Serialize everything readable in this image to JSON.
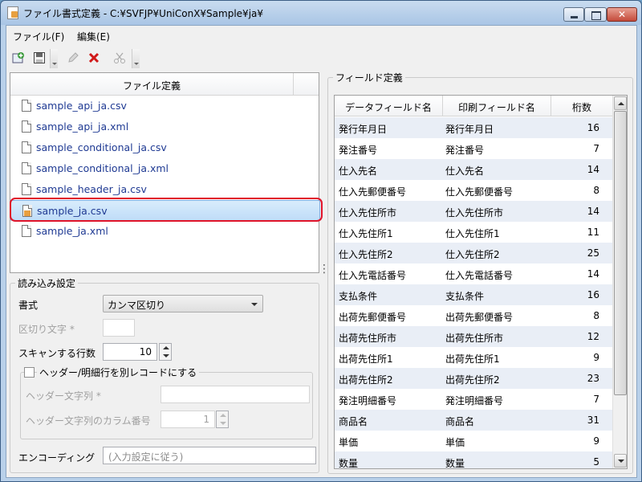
{
  "window": {
    "title": "ファイル書式定義 - C:¥SVFJP¥UniConX¥Sample¥ja¥",
    "close_glyph": "✕"
  },
  "menu": {
    "file": "ファイル(F)",
    "edit": "編集(E)"
  },
  "toolbar": {
    "new_icon": "add-icon",
    "save_icon": "save-icon",
    "edit_icon": "pencil-icon",
    "delete_icon": "delete-icon",
    "cut_icon": "scissors-icon"
  },
  "file_panel": {
    "header": "ファイル定義",
    "files": [
      "sample_api_ja.csv",
      "sample_api_ja.xml",
      "sample_conditional_ja.csv",
      "sample_conditional_ja.xml",
      "sample_header_ja.csv",
      "sample_ja.csv",
      "sample_ja.xml"
    ],
    "selected_index": 5
  },
  "read_settings": {
    "legend": "読み込み設定",
    "format_label": "書式",
    "format_value": "カンマ区切り",
    "delimiter_label": "区切り文字 *",
    "scan_rows_label": "スキャンする行数",
    "scan_rows_value": "10",
    "header_detail_label": "ヘッダー/明細行を別レコードにする",
    "header_string_label": "ヘッダー文字列 *",
    "header_column_label": "ヘッダー文字列のカラム番号",
    "header_column_value": "1",
    "encoding_label": "エンコーディング",
    "encoding_placeholder": "(入力設定に従う)"
  },
  "field_definition": {
    "legend": "フィールド定義",
    "columns": [
      "データフィールド名",
      "印刷フィールド名",
      "桁数"
    ],
    "rows": [
      [
        "発行年月日",
        "発行年月日",
        "16"
      ],
      [
        "発注番号",
        "発注番号",
        "7"
      ],
      [
        "仕入先名",
        "仕入先名",
        "14"
      ],
      [
        "仕入先郵便番号",
        "仕入先郵便番号",
        "8"
      ],
      [
        "仕入先住所市",
        "仕入先住所市",
        "14"
      ],
      [
        "仕入先住所1",
        "仕入先住所1",
        "11"
      ],
      [
        "仕入先住所2",
        "仕入先住所2",
        "25"
      ],
      [
        "仕入先電話番号",
        "仕入先電話番号",
        "14"
      ],
      [
        "支払条件",
        "支払条件",
        "16"
      ],
      [
        "出荷先郵便番号",
        "出荷先郵便番号",
        "8"
      ],
      [
        "出荷先住所市",
        "出荷先住所市",
        "12"
      ],
      [
        "出荷先住所1",
        "出荷先住所1",
        "9"
      ],
      [
        "出荷先住所2",
        "出荷先住所2",
        "23"
      ],
      [
        "発注明細番号",
        "発注明細番号",
        "7"
      ],
      [
        "商品名",
        "商品名",
        "31"
      ],
      [
        "単価",
        "単価",
        "9"
      ],
      [
        "数量",
        "数量",
        "5"
      ]
    ]
  },
  "colors": {
    "link_text": "#1f3a93",
    "selection_outline": "#e0142a",
    "alt_row": "#e9eef6"
  }
}
